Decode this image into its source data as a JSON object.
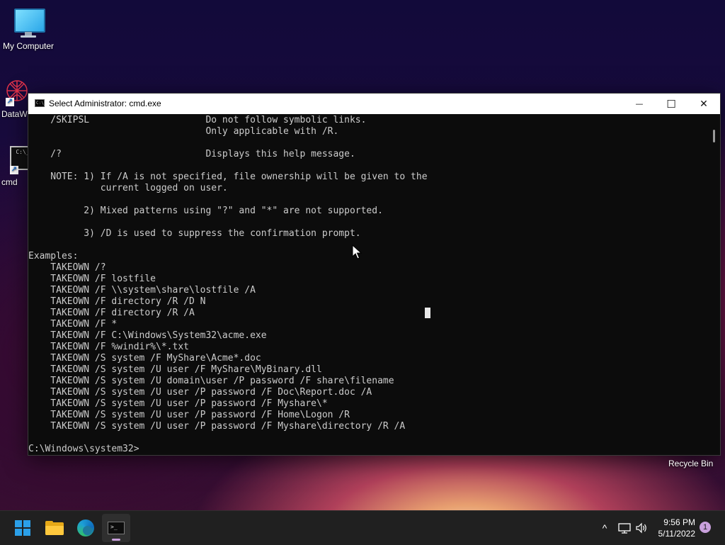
{
  "desktop": {
    "icons": [
      {
        "label": "My Computer"
      },
      {
        "label": "DataW"
      },
      {
        "label": "cmd"
      }
    ],
    "recycle_bin_label": "Recycle Bin"
  },
  "window": {
    "title": "Select Administrator: cmd.exe",
    "title_icon_text": "C:\\_",
    "minimize_glyph": "—",
    "maximize_glyph": "☐",
    "close_glyph": "✕"
  },
  "console": {
    "lines": [
      "    /SKIPSL                     Do not follow symbolic links.",
      "                                Only applicable with /R.",
      "",
      "    /?                          Displays this help message.",
      "",
      "    NOTE: 1) If /A is not specified, file ownership will be given to the",
      "             current logged on user.",
      "",
      "          2) Mixed patterns using \"?\" and \"*\" are not supported.",
      "",
      "          3) /D is used to suppress the confirmation prompt.",
      "",
      "Examples:",
      "    TAKEOWN /?",
      "    TAKEOWN /F lostfile",
      "    TAKEOWN /F \\\\system\\share\\lostfile /A",
      "    TAKEOWN /F directory /R /D N",
      "    TAKEOWN /F directory /R /A",
      "    TAKEOWN /F *",
      "    TAKEOWN /F C:\\Windows\\System32\\acme.exe",
      "    TAKEOWN /F %windir%\\*.txt",
      "    TAKEOWN /S system /F MyShare\\Acme*.doc",
      "    TAKEOWN /S system /U user /F MyShare\\MyBinary.dll",
      "    TAKEOWN /S system /U domain\\user /P password /F share\\filename",
      "    TAKEOWN /S system /U user /P password /F Doc\\Report.doc /A",
      "    TAKEOWN /S system /U user /P password /F Myshare\\*",
      "    TAKEOWN /S system /U user /P password /F Home\\Logon /R",
      "    TAKEOWN /S system /U user /P password /F Myshare\\directory /R /A",
      "",
      "C:\\Windows\\system32>"
    ]
  },
  "taskbar": {
    "apps": [
      {
        "name": "start"
      },
      {
        "name": "file-explorer"
      },
      {
        "name": "edge"
      },
      {
        "name": "terminal",
        "icon_text": ">_"
      }
    ],
    "tray": {
      "chevron_glyph": "^",
      "clock_time": "9:56 PM",
      "clock_date": "5/11/2022",
      "notification_count": "1"
    }
  }
}
